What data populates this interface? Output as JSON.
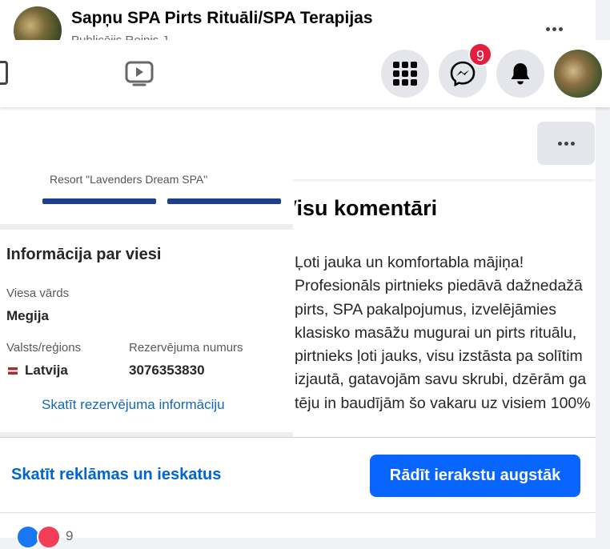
{
  "post": {
    "page_name": "Sapņu SPA Pirts Rituāli/SPA Terapijas",
    "page_sub": "Publicējis Reinis J."
  },
  "topbar": {
    "messenger_badge": "9"
  },
  "shot": {
    "cut_text": "Resort \"Lavenders Dream SPA\"",
    "heading": "Informācija par viesi",
    "guest_name_label": "Viesa vārds",
    "guest_name": "Megija",
    "country_label": "Valsts/reģions",
    "country": "Latvija",
    "booking_label": "Rezervējuma numurs",
    "booking_number": "3076353830",
    "link": "Skatīt rezervējuma informāciju"
  },
  "review": {
    "title": "Visu komentāri",
    "lines": [
      "Ļoti jauka un komfortabla mājiņa!",
      "Profesionāls pirtnieks piedāvā dažnedažā",
      "pirts, SPA pakalpojumus, izvelējāmies",
      "klasisko masāžu mugurai un pirts rituālu,",
      "pirtnieks ļoti jauks, visu izstāsta pa solītim",
      "izjautā, gatavojām savu skrubi, dzērām ga",
      "tēju in baudījām šo vakaru uz visiem 100%"
    ]
  },
  "footer": {
    "insights_link": "Skatīt reklāmas un ieskatus",
    "boost_button": "Rādīt ierakstu augstāk",
    "reaction_count": "9"
  }
}
